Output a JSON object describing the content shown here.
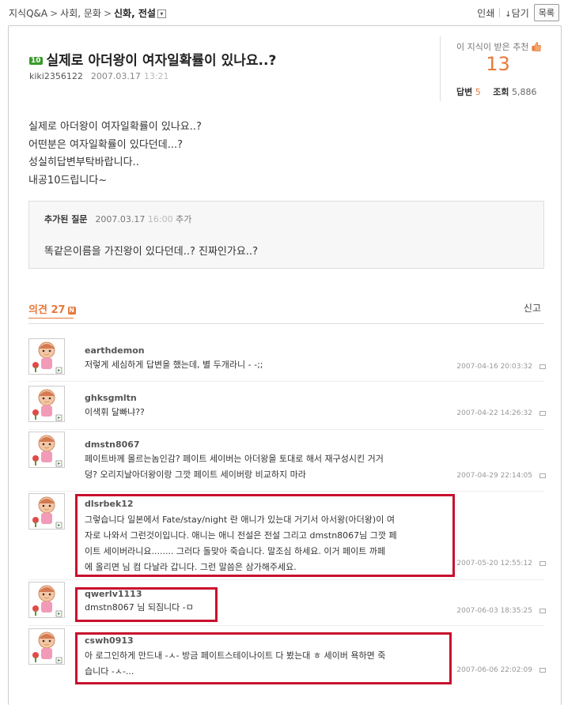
{
  "breadcrumb": {
    "root": "지식Q&A",
    "sep1": ">",
    "cat": "사회, 문화",
    "sep2": ">",
    "current": "신화, 전설",
    "dropdown": "▾"
  },
  "actions": {
    "print": "인쇄",
    "save_icon": "↓",
    "save": "담기",
    "list": "목록"
  },
  "question": {
    "level": "10",
    "title": "실제로 아더왕이 여자일확률이 있나요..?",
    "author": "kiki2356122",
    "date": "2007.03.17",
    "time": "13:21",
    "body": [
      "실제로 아더왕이 여자일확률이 있나요..?",
      "어떤분은 여자일확률이 있다던데...?",
      "성실히답변부탁바랍니다..",
      "내공10드립니다~"
    ]
  },
  "stats": {
    "rec_label": "이 지식이 받은 추천",
    "rec_count": "13",
    "answer_label": "답변",
    "answer_count": "5",
    "view_label": "조회",
    "view_count": "5,886"
  },
  "added": {
    "label": "추가된 질문",
    "date": "2007.03.17",
    "time": "16:00",
    "suffix": "추가",
    "text": "똑같은이름을 가진왕이 있다던데..? 진짜인가요..?"
  },
  "opinions": {
    "label": "의견 27",
    "badge": "N",
    "report": "신고"
  },
  "comments": [
    {
      "user": "earthdemon",
      "lines": [
        "저렇게 세심하게 답변을 했는데, 별 두개라니 - -;;"
      ],
      "date": "2007-04-16 20:03:32"
    },
    {
      "user": "ghksgmltn",
      "lines": [
        "이색휘 달빠냐??"
      ],
      "date": "2007-04-22 14:26:32"
    },
    {
      "user": "dmstn8067",
      "lines": [
        "페이트바께 몰르는놈인감? 페이트 세이버는 아더왕을 토대로 해서 재구성시킨 거거",
        "덩? 오리지날아더왕이랑 그깟 페이트 세이버랑 비교하지 마라"
      ],
      "date": "2007-04-29 22:14:05"
    },
    {
      "user": "dlsrbek12",
      "lines": [
        "그렇습니다 일본에서 Fate/stay/night 란 애니가 있는대 거기서 아서왕(아더왕)이 여",
        "자로 나와서 그런것이입니다. 애니는 애니 전설은 전설 그리고 dmstn8067님 그깟 페",
        "이트 세이버라니요........ 그러다 돌맞아 죽습니다. 말조심 하세요. 이거 페이트 까페",
        "에 올리면 님 컴 다날라 갑니다. 그런 말씀은 삼가해주세요."
      ],
      "date": "2007-05-20 12:55:12"
    },
    {
      "user": "qwerlv1113",
      "lines": [
        "dmstn8067 님 되짐니다 -ㅁ"
      ],
      "date": "2007-06-03 18:35:25"
    },
    {
      "user": "cswh0913",
      "lines": [
        "아 로그인하게 만드내 -ㅅ- 방금 페이트스테이나이트 다 봤는대 ㅎ 세이버 욕하면 죽",
        "습니다 -ㅅ-..."
      ],
      "date": "2007-06-06 22:02:09"
    }
  ],
  "colors": {
    "accent": "#e8793a",
    "highlight": "#c8102e",
    "level": "#3a9a2c"
  }
}
